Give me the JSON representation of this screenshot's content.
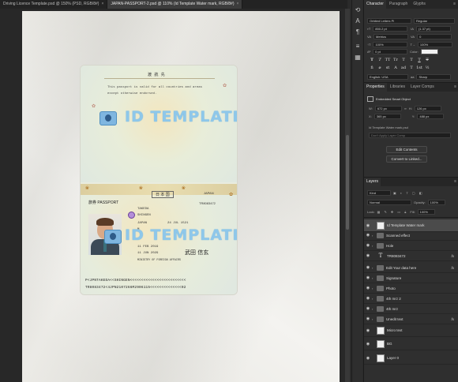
{
  "tabs": [
    {
      "label": "Driving Licence Template.psd @ 150% (PSD, RGB/8#)",
      "active": false
    },
    {
      "label": "JAPAN-PASSPORT-2.psd @ 110% (Id Template Water mark, RGB/8#)",
      "active": true
    }
  ],
  "passport": {
    "top_header": "渡 航 先",
    "line1": "This passport is valid for all countries and areas",
    "line2": "except otherwise endorsed.",
    "watermark": "ID TEMPLATE",
    "kanji": "日 本 国",
    "japan": "JAPAN",
    "passport_label": "旅券 PASSPORT",
    "number": "TR8083472",
    "surname": "TAKEDA",
    "given": "SHINGEN",
    "nationality": "JAPAN",
    "dob": "24 JUL 1521",
    "sex": "M",
    "issue": "11 FEB 2019",
    "expiry": "11 JUN 2029",
    "authority": "MINISTRY OF FOREIGN AFFAIRS",
    "signature": "武田 信玄",
    "mrz1": "P<JPNTAKEDA<<SHINGEN<<<<<<<<<<<<<<<<<<<<<<<<<",
    "mrz2": "TR8083472<4JPN2107266M2906115<<<<<<<<<<<<<<02"
  },
  "character": {
    "tabs": [
      "Character",
      "Paragraph",
      "Glyphs"
    ],
    "font_family": "Orbited Letters Pi",
    "font_style": "Regular",
    "font_size": "850.2 pt",
    "leading": "(1.37 pt)",
    "kerning": "Metrics",
    "tracking": "0",
    "vscale": "100%",
    "hscale": "100%",
    "baseline": "0 pt",
    "color_label": "Color:",
    "type_buttons": [
      "T",
      "T",
      "TT",
      "Tr",
      "T",
      "T",
      "T",
      "T"
    ],
    "extra": [
      "fi",
      "ø",
      "st",
      "A",
      "ad",
      "T",
      "1st",
      "½"
    ],
    "language": "English: USA",
    "aa_label": "aa",
    "aa": "Sharp"
  },
  "properties": {
    "tabs": [
      "Properties",
      "Libraries",
      "Layer Comps"
    ],
    "type": "Embedded Smart Object",
    "w_label": "W:",
    "w": "672 px",
    "h_label": "H:",
    "h": "126 px",
    "x_label": "X:",
    "x": "365 px",
    "y_label": "Y:",
    "y": "488 px",
    "file": "Id Template Water mark.psd",
    "comp": "Don't Apply Layer Comp",
    "edit_button": "Edit Contents",
    "convert_button": "Convert to Linked..."
  },
  "layers": {
    "tab": "Layers",
    "kind": "Kind",
    "blend": "Normal",
    "opacity_label": "Opacity:",
    "opacity": "100%",
    "lock_label": "Lock:",
    "fill_label": "Fill:",
    "fill": "100%",
    "items": [
      {
        "name": "Id Template Water mark",
        "kind": "smart",
        "selected": true,
        "fx": ""
      },
      {
        "name": "Scanned effect",
        "kind": "folder",
        "selected": false,
        "fx": ""
      },
      {
        "name": "Hole",
        "kind": "folder",
        "selected": false,
        "fx": ""
      },
      {
        "name": "TR8083472",
        "kind": "text",
        "selected": false,
        "fx": "fx"
      },
      {
        "name": "Edit Your data here",
        "kind": "folder",
        "selected": false,
        "fx": "fx"
      },
      {
        "name": "Signature",
        "kind": "folder",
        "selected": false,
        "fx": ""
      },
      {
        "name": "Photo",
        "kind": "folder",
        "selected": false,
        "fx": ""
      },
      {
        "name": "4th mrz 2",
        "kind": "folder",
        "selected": false,
        "fx": ""
      },
      {
        "name": "4th mrz",
        "kind": "folder",
        "selected": false,
        "fx": ""
      },
      {
        "name": "Unedit text",
        "kind": "folder",
        "selected": false,
        "fx": "fx"
      },
      {
        "name": "Micro text",
        "kind": "smart",
        "selected": false,
        "fx": ""
      },
      {
        "name": "BG",
        "kind": "smart",
        "selected": false,
        "fx": ""
      },
      {
        "name": "Layer 0",
        "kind": "smart",
        "selected": false,
        "fx": ""
      }
    ]
  }
}
